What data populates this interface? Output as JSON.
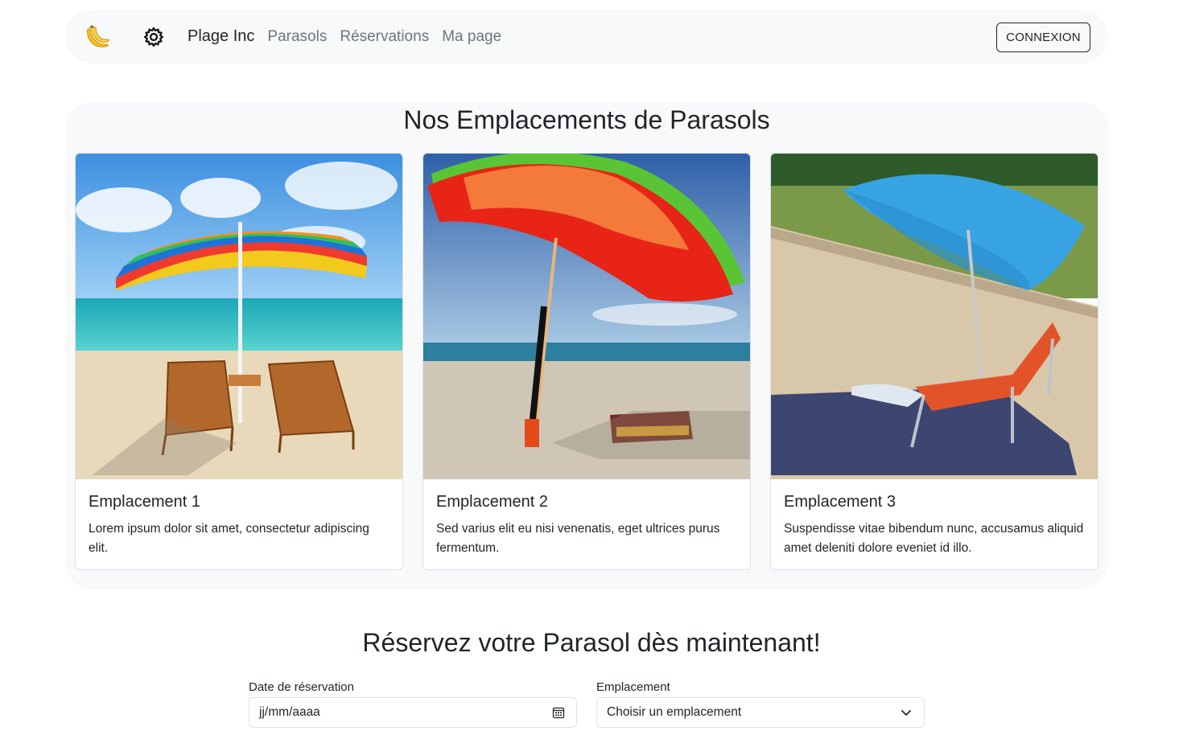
{
  "navbar": {
    "logo_icon": "banana-icon",
    "settings_icon": "gear-icon",
    "brand": "Plage Inc",
    "links": [
      "Parasols",
      "Réservations",
      "Ma page"
    ],
    "login_label": "CONNEXION"
  },
  "locations": {
    "title": "Nos Emplacements de Parasols",
    "cards": [
      {
        "title": "Emplacement 1",
        "text": "Lorem ipsum dolor sit amet, consectetur adipiscing elit."
      },
      {
        "title": "Emplacement 2",
        "text": "Sed varius elit eu nisi venenatis, eget ultrices purus fermentum."
      },
      {
        "title": "Emplacement 3",
        "text": "Suspendisse vitae bibendum nunc, accusamus aliquid amet deleniti dolore eveniet id illo."
      }
    ]
  },
  "reservation": {
    "title": "Réservez votre Parasol dès maintenant!",
    "date_label": "Date de réservation",
    "date_placeholder": "jj/mm/aaaa",
    "date_icon": "calendar-icon",
    "location_label": "Emplacement",
    "location_selected": "Choisir un emplacement",
    "location_icon": "chevron-down-icon"
  },
  "colors": {
    "panel_bg": "#f8f9fa",
    "text": "#212529",
    "muted": "#6c757d",
    "border": "#dee2e6"
  }
}
